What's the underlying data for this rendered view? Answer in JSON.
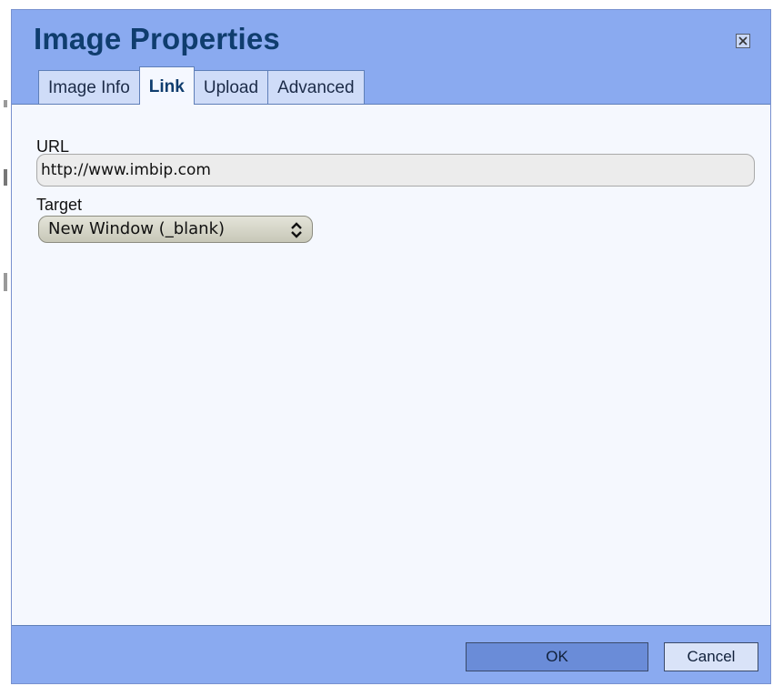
{
  "dialog": {
    "title": "Image Properties",
    "close_icon": "close-icon"
  },
  "tabs": [
    {
      "label": "Image Info",
      "active": false
    },
    {
      "label": "Link",
      "active": true
    },
    {
      "label": "Upload",
      "active": false
    },
    {
      "label": "Advanced",
      "active": false
    }
  ],
  "link": {
    "url_label": "URL",
    "url_value": "http://www.imbip.com",
    "target_label": "Target",
    "target_value": "New Window (_blank)"
  },
  "footer": {
    "ok_label": "OK",
    "cancel_label": "Cancel"
  },
  "colors": {
    "accent": "#8aaaf0",
    "title": "#0f3d6e",
    "content_bg": "#f5f8fe"
  }
}
